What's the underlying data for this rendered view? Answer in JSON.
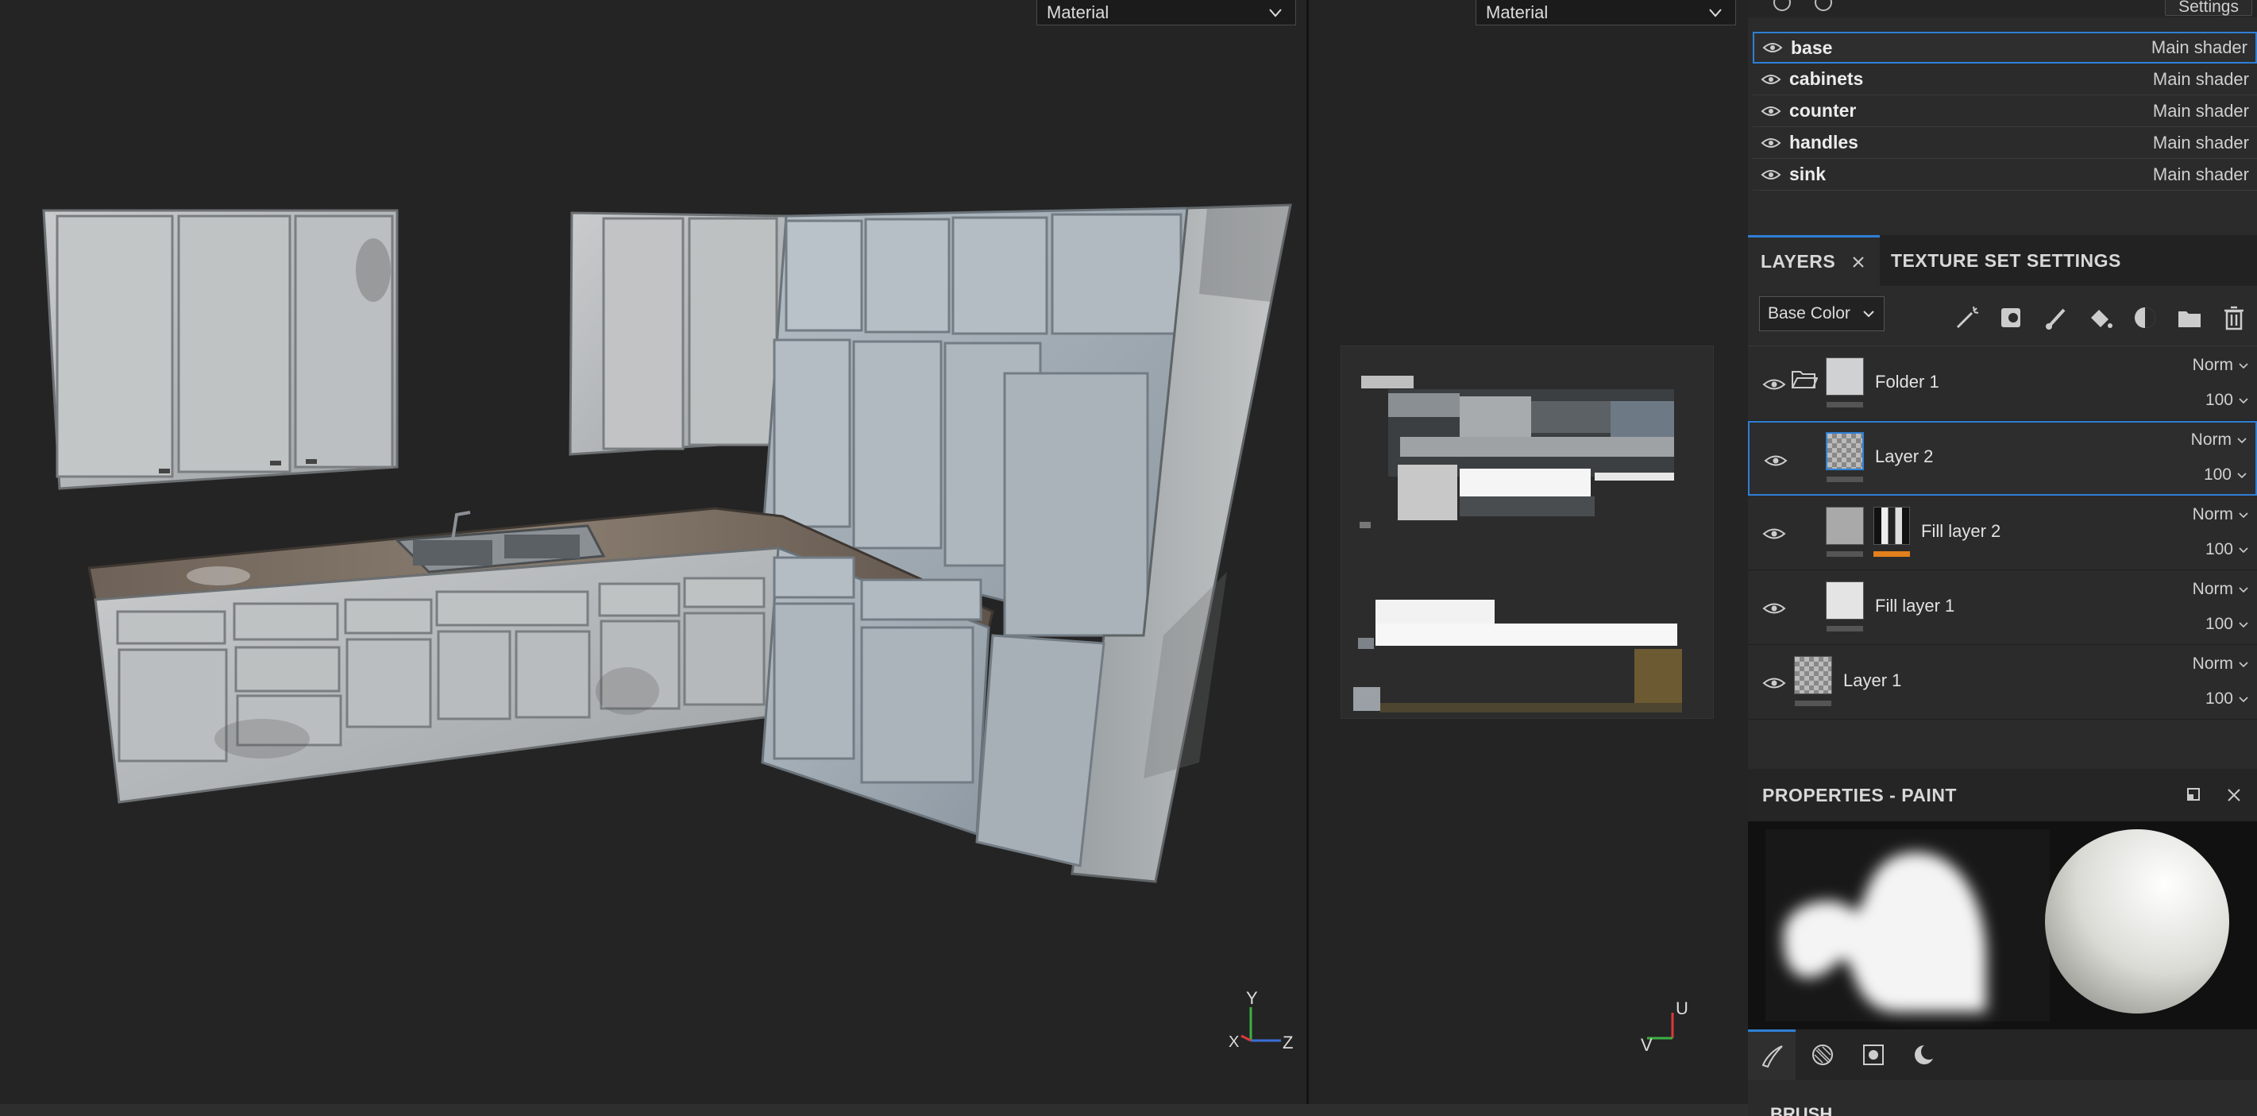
{
  "viewport3d": {
    "mode_dropdown": "Material",
    "axis": {
      "y": "Y",
      "x": "X",
      "z": "Z"
    }
  },
  "viewport2d": {
    "mode_dropdown": "Material",
    "axis": {
      "u": "U",
      "v": "V"
    }
  },
  "texture_sets": {
    "settings_label": "Settings",
    "items": [
      {
        "name": "base",
        "shader": "Main shader",
        "selected": true
      },
      {
        "name": "cabinets",
        "shader": "Main shader"
      },
      {
        "name": "counter",
        "shader": "Main shader"
      },
      {
        "name": "handles",
        "shader": "Main shader"
      },
      {
        "name": "sink",
        "shader": "Main shader"
      }
    ]
  },
  "tabs": {
    "layers": "LAYERS",
    "texture_set_settings": "TEXTURE SET SETTINGS"
  },
  "toolbar": {
    "channel": "Base Color",
    "icons": [
      "magic-wand-icon",
      "mask-icon",
      "brush-icon",
      "fill-icon",
      "smart-material-icon",
      "folder-icon",
      "trash-icon"
    ]
  },
  "layers": [
    {
      "name": "Folder 1",
      "blend": "Norm",
      "opacity": "100",
      "type": "folder"
    },
    {
      "name": "Layer 2",
      "blend": "Norm",
      "opacity": "100",
      "type": "paint",
      "selected": true
    },
    {
      "name": "Fill layer 2",
      "blend": "Norm",
      "opacity": "100",
      "type": "fill-masked"
    },
    {
      "name": "Fill layer 1",
      "blend": "Norm",
      "opacity": "100",
      "type": "fill"
    },
    {
      "name": "Layer 1",
      "blend": "Norm",
      "opacity": "100",
      "type": "paint"
    }
  ],
  "properties": {
    "title": "PROPERTIES - PAINT"
  },
  "brush_section": {
    "label": "BRUSH"
  },
  "colors": {
    "accent": "#2f7fd6",
    "mask_orange": "#e2801c",
    "panel": "#2b2b2b",
    "viewport": "#242424"
  }
}
